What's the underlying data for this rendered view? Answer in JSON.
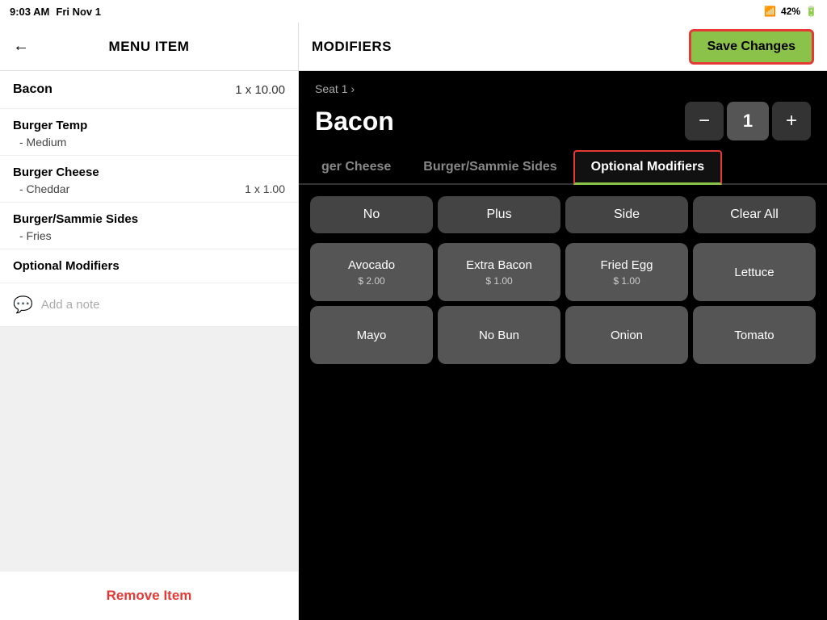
{
  "status_bar": {
    "time": "9:03 AM",
    "date": "Fri Nov 1",
    "battery": "42%",
    "wifi_icon": "wifi",
    "battery_icon": "battery"
  },
  "header": {
    "back_label": "←",
    "left_title": "MENU ITEM",
    "modifiers_title": "MODIFIERS",
    "save_button": "Save Changes"
  },
  "left_panel": {
    "order_item": {
      "name": "Bacon",
      "price": "1 x 10.00"
    },
    "modifier_groups": [
      {
        "name": "Burger Temp",
        "values": [
          {
            "label": "- Medium",
            "price": ""
          }
        ]
      },
      {
        "name": "Burger Cheese",
        "values": [
          {
            "label": "- Cheddar",
            "price": "1 x 1.00"
          }
        ]
      },
      {
        "name": "Burger/Sammie Sides",
        "values": [
          {
            "label": "- Fries",
            "price": ""
          }
        ]
      }
    ],
    "optional_modifiers_label": "Optional Modifiers",
    "add_note_placeholder": "Add a note",
    "remove_item_label": "Remove Item"
  },
  "right_panel": {
    "breadcrumb": "Seat 1",
    "breadcrumb_chevron": "›",
    "item_name": "Bacon",
    "quantity": "1",
    "minus_label": "−",
    "plus_label": "+",
    "tabs": [
      {
        "label": "ger Cheese",
        "active": false
      },
      {
        "label": "Burger/Sammie Sides",
        "active": false
      },
      {
        "label": "Optional Modifiers",
        "active": true
      }
    ],
    "action_buttons": [
      {
        "label": "No"
      },
      {
        "label": "Plus"
      },
      {
        "label": "Side"
      },
      {
        "label": "Clear All"
      }
    ],
    "modifier_options": [
      {
        "label": "Avocado",
        "price": "$ 2.00"
      },
      {
        "label": "Extra Bacon",
        "price": "$ 1.00"
      },
      {
        "label": "Fried Egg",
        "price": "$ 1.00"
      },
      {
        "label": "Lettuce",
        "price": ""
      },
      {
        "label": "Mayo",
        "price": ""
      },
      {
        "label": "No Bun",
        "price": ""
      },
      {
        "label": "Onion",
        "price": ""
      },
      {
        "label": "Tomato",
        "price": ""
      }
    ]
  }
}
